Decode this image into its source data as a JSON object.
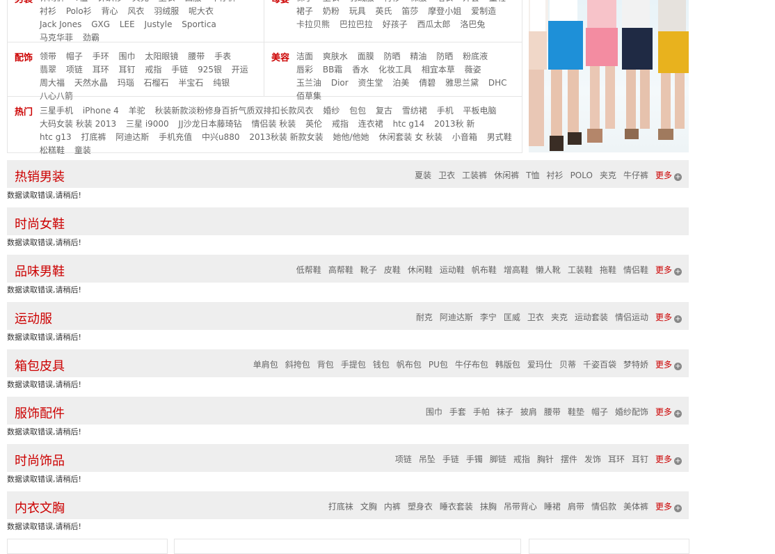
{
  "categories": [
    {
      "title": "男装",
      "links": [
        "休闲裤",
        "T恤",
        "针织衫",
        "夹克",
        "卫衣",
        "西服",
        "牛仔裤",
        "衬衫",
        "Polo衫",
        "背心",
        "风衣",
        "羽绒服",
        "呢大衣",
        "Jack Jones",
        "GXG",
        "LEE",
        "Justyle",
        "Sportica",
        "马克华菲",
        "劲霸"
      ]
    },
    {
      "title": "母婴",
      "links": [
        "袜子",
        "卫衣",
        "羽绒服",
        "衬衫",
        "棉服",
        "唱衣",
        "外套",
        "童鞋",
        "裙子",
        "奶粉",
        "玩具",
        "英氏",
        "笛莎",
        "摩登小姐",
        "爱制造",
        "卡拉贝熊",
        "巴拉巴拉",
        "好孩子",
        "西瓜太郎",
        "洛巴兔"
      ]
    },
    {
      "title": "配饰",
      "links": [
        "领带",
        "帽子",
        "手环",
        "围巾",
        "太阳眼镜",
        "腰带",
        "手表",
        "翡翠",
        "项链",
        "耳环",
        "耳钉",
        "戒指",
        "手链",
        "925银",
        "开运",
        "周大福",
        "天然水晶",
        "玛瑙",
        "石榴石",
        "半宝石",
        "纯银",
        "八心八箭"
      ]
    },
    {
      "title": "美容",
      "links": [
        "洁面",
        "爽肤水",
        "面膜",
        "防晒",
        "精油",
        "防晒",
        "粉底液",
        "唇彩",
        "BB霜",
        "香水",
        "化妆工具",
        "相宜本草",
        "薇姿",
        "玉兰油",
        "Dior",
        "资生堂",
        "泊美",
        "倩碧",
        "雅思兰黛",
        "DHC",
        "佰草集"
      ]
    },
    {
      "title": "热门",
      "links": [
        "三星手机",
        "iPhone 4",
        "羊驼",
        "秋装新款淡粉修身百折气质双排扣长款风衣",
        "婚纱",
        "包包",
        "复古",
        "雪纺裙",
        "手机",
        "平板电脑",
        "大码女装 秋装 2013",
        "三星 i9000",
        "JJ沙龙日本藤琦钻",
        "情侣装 秋装",
        "英伦",
        "戒指",
        "连衣裙",
        "htc g14",
        "2013秋 新",
        "htc g13",
        "打底裤",
        "阿迪达斯",
        "手机充值",
        "中兴u880",
        "2013秋装 新款女装",
        "她他/他她",
        "休闲套装 女 秋装",
        "小音箱",
        "男式鞋",
        "松糕鞋",
        "童装"
      ]
    }
  ],
  "sections": [
    {
      "title": "热销男装",
      "tags": [
        "夏装",
        "卫衣",
        "工装裤",
        "休闲裤",
        "T恤",
        "衬衫",
        "POLO",
        "夹克",
        "牛仔裤"
      ]
    },
    {
      "title": "时尚女鞋",
      "tags": []
    },
    {
      "title": "品味男鞋",
      "tags": [
        "低帮鞋",
        "高帮鞋",
        "靴子",
        "皮鞋",
        "休闲鞋",
        "运动鞋",
        "帆布鞋",
        "增高鞋",
        "懒人靴",
        "工装鞋",
        "拖鞋",
        "情侣鞋"
      ]
    },
    {
      "title": "运动服",
      "tags": [
        "耐克",
        "阿迪达斯",
        "李宁",
        "匡威",
        "卫衣",
        "夹克",
        "运动套装",
        "情侣运动"
      ]
    },
    {
      "title": "箱包皮具",
      "tags": [
        "单肩包",
        "斜挎包",
        "背包",
        "手提包",
        "钱包",
        "帆布包",
        "PU包",
        "牛仔布包",
        "韩版包",
        "爱玛仕",
        "贝蒂",
        "千姿百袋",
        "梦特娇"
      ]
    },
    {
      "title": "服饰配件",
      "tags": [
        "围巾",
        "手套",
        "手帕",
        "袜子",
        "披肩",
        "腰带",
        "鞋垫",
        "帽子",
        "婚纱配饰"
      ]
    },
    {
      "title": "时尚饰品",
      "tags": [
        "项链",
        "吊坠",
        "手链",
        "手镯",
        "脚链",
        "戒指",
        "胸针",
        "摆件",
        "发饰",
        "耳环",
        "耳钉"
      ]
    },
    {
      "title": "内衣文胸",
      "tags": [
        "打底袜",
        "文胸",
        "内裤",
        "塑身衣",
        "睡衣套装",
        "抹胸",
        "吊带背心",
        "睡裙",
        "肩带",
        "情侣款",
        "美体裤"
      ]
    }
  ],
  "more_label": "更多",
  "error_text": "数据读取错误,请稍后!",
  "colors": {
    "accent": "#cc0000",
    "bar_bg": "#eeeeee"
  }
}
